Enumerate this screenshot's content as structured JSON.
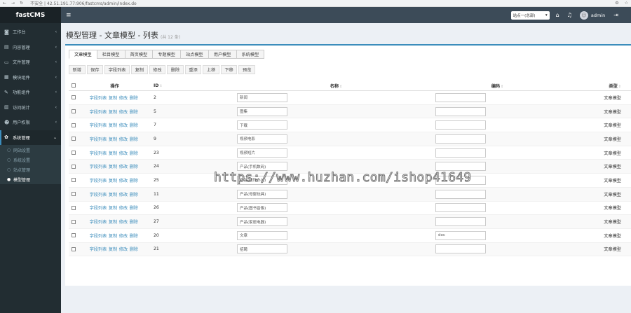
{
  "browser": {
    "address": "不安全 | 42.51.191.77:906/fastcms/admin/index.do"
  },
  "sidebar": {
    "logo": "fastCMS",
    "items": [
      {
        "label": "工作台",
        "icon": "dashboard-icon",
        "glyph": "◙",
        "active": false
      },
      {
        "label": "内容管理",
        "icon": "content-icon",
        "glyph": "▤",
        "active": false
      },
      {
        "label": "文件管理",
        "icon": "folder-icon",
        "glyph": "▭",
        "active": false
      },
      {
        "label": "模块组件",
        "icon": "module-icon",
        "glyph": "▦",
        "active": false
      },
      {
        "label": "功能组件",
        "icon": "wrench-icon",
        "glyph": "✎",
        "active": false
      },
      {
        "label": "访问统计",
        "icon": "chart-icon",
        "glyph": "▥",
        "active": false
      },
      {
        "label": "用户权限",
        "icon": "user-icon",
        "glyph": "☻",
        "active": false
      },
      {
        "label": "系统管理",
        "icon": "gear-icon",
        "glyph": "✿",
        "active": true
      }
    ],
    "submenu": [
      {
        "label": "网站设置",
        "active": false
      },
      {
        "label": "系统设置",
        "active": false
      },
      {
        "label": "站点管理",
        "active": false
      },
      {
        "label": "模型管理",
        "active": true
      }
    ]
  },
  "topbar": {
    "site_select": "站点一(总部)",
    "user": "admin"
  },
  "page": {
    "title": "模型管理 - 文章模型 - 列表",
    "count": "(共 12 条)"
  },
  "tabs": [
    "文章模型",
    "栏目模型",
    "首页模型",
    "专题模型",
    "站点模型",
    "用户模型",
    "系统模型"
  ],
  "toolbar": [
    "新增",
    "保存",
    "字段列表",
    "复制",
    "修改",
    "删除",
    "重添",
    "上移",
    "下移",
    "预览"
  ],
  "table": {
    "headers": {
      "op": "操作",
      "id": "ID",
      "name": "名称",
      "code": "编码",
      "type": "类型"
    },
    "sort_glyph": "⇕",
    "row_actions": [
      "字段列表",
      "复制",
      "修改",
      "删除"
    ],
    "rows": [
      {
        "id": "2",
        "name": "新闻",
        "code": "",
        "type": "文章模型"
      },
      {
        "id": "5",
        "name": "图集",
        "code": "",
        "type": "文章模型"
      },
      {
        "id": "7",
        "name": "下载",
        "code": "",
        "type": "文章模型"
      },
      {
        "id": "9",
        "name": "视频电影",
        "code": "",
        "type": "文章模型"
      },
      {
        "id": "23",
        "name": "视频短片",
        "code": "",
        "type": "文章模型"
      },
      {
        "id": "24",
        "name": "产品(手机数码)",
        "code": "",
        "type": "文章模型"
      },
      {
        "id": "25",
        "name": "产品(服饰办公)",
        "code": "",
        "type": "文章模型"
      },
      {
        "id": "11",
        "name": "产品(母婴玩具)",
        "code": "",
        "type": "文章模型"
      },
      {
        "id": "26",
        "name": "产品(图书音像)",
        "code": "",
        "type": "文章模型"
      },
      {
        "id": "27",
        "name": "产品(家居电器)",
        "code": "",
        "type": "文章模型"
      },
      {
        "id": "20",
        "name": "文章",
        "code": "doc",
        "type": "文章模型"
      },
      {
        "id": "21",
        "name": "招聘",
        "code": "",
        "type": "文章模型"
      }
    ]
  },
  "watermark": "https://www.huzhan.com/ishop41649"
}
